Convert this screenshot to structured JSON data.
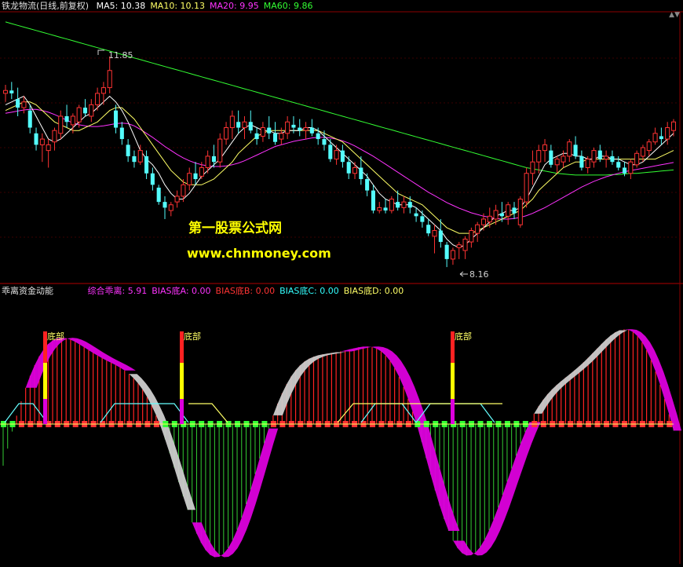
{
  "upper": {
    "title": "铁龙物流(日线,前复权)",
    "ma_labels": [
      {
        "text": "MA5: 10.38",
        "color": "#ffffff"
      },
      {
        "text": "MA10: 10.13",
        "color": "#ffff66"
      },
      {
        "text": "MA20: 9.95",
        "color": "#ff33ff"
      },
      {
        "text": "MA60: 9.86",
        "color": "#33ff33"
      }
    ],
    "high_label": "11.85",
    "low_label": "8.16",
    "ylim": [
      7.9,
      12.6
    ]
  },
  "lower": {
    "title": "乖离资金动能",
    "indicators": [
      {
        "text": "综合乖离: 5.91",
        "color": "#ff33ff"
      },
      {
        "text": "BIAS底A: 0.00",
        "color": "#ff33ff"
      },
      {
        "text": "BIAS底B: 0.00",
        "color": "#ff3333"
      },
      {
        "text": "BIAS底C: 0.00",
        "color": "#33ffff"
      },
      {
        "text": "BIAS底D: 0.00",
        "color": "#ffff66"
      }
    ],
    "bottom_marker_label": "底部"
  },
  "watermark": {
    "line1": "第一股票公式网",
    "line2": "www.chnmoney.com"
  },
  "colors": {
    "up": "#ff3333",
    "down": "#54fcfc",
    "ma5": "#ffffff",
    "ma10": "#ffff66",
    "ma20": "#ff33ff",
    "ma60": "#33ff33",
    "grid": "#8b0000"
  },
  "chart_data": {
    "type": "candlestick",
    "ohlc": [
      [
        11.2,
        11.35,
        11.05,
        11.25
      ],
      [
        11.25,
        11.4,
        11.1,
        11.2
      ],
      [
        11.1,
        11.3,
        10.8,
        10.95
      ],
      [
        10.95,
        11.15,
        10.85,
        11.05
      ],
      [
        10.9,
        11.0,
        10.5,
        10.6
      ],
      [
        10.5,
        10.6,
        10.2,
        10.3
      ],
      [
        10.3,
        10.5,
        10.0,
        10.4
      ],
      [
        10.2,
        10.4,
        9.9,
        10.3
      ],
      [
        10.35,
        10.6,
        10.2,
        10.55
      ],
      [
        10.5,
        10.9,
        10.4,
        10.8
      ],
      [
        10.8,
        11.0,
        10.6,
        10.7
      ],
      [
        10.65,
        10.85,
        10.5,
        10.8
      ],
      [
        10.7,
        11.0,
        10.6,
        10.95
      ],
      [
        10.95,
        11.1,
        10.8,
        10.85
      ],
      [
        10.8,
        11.1,
        10.7,
        11.0
      ],
      [
        11.0,
        11.3,
        10.9,
        11.2
      ],
      [
        11.2,
        11.4,
        11.0,
        11.3
      ],
      [
        11.3,
        11.85,
        11.2,
        11.6
      ],
      [
        10.9,
        11.0,
        10.5,
        10.6
      ],
      [
        10.6,
        10.7,
        10.3,
        10.4
      ],
      [
        10.3,
        10.4,
        10.0,
        10.1
      ],
      [
        10.1,
        10.2,
        9.9,
        10.0
      ],
      [
        10.0,
        10.3,
        9.95,
        10.2
      ],
      [
        10.1,
        10.2,
        9.7,
        9.8
      ],
      [
        9.8,
        9.9,
        9.5,
        9.6
      ],
      [
        9.55,
        9.6,
        9.25,
        9.3
      ],
      [
        9.3,
        9.4,
        9.0,
        9.2
      ],
      [
        9.15,
        9.3,
        9.05,
        9.25
      ],
      [
        9.3,
        9.5,
        9.2,
        9.4
      ],
      [
        9.4,
        9.7,
        9.3,
        9.6
      ],
      [
        9.6,
        9.9,
        9.5,
        9.8
      ],
      [
        9.8,
        10.0,
        9.6,
        9.7
      ],
      [
        9.75,
        10.0,
        9.7,
        9.9
      ],
      [
        9.9,
        10.2,
        9.8,
        10.1
      ],
      [
        10.1,
        10.3,
        9.9,
        10.0
      ],
      [
        10.0,
        10.5,
        9.9,
        10.4
      ],
      [
        10.4,
        10.7,
        10.3,
        10.6
      ],
      [
        10.6,
        10.9,
        10.4,
        10.8
      ],
      [
        10.7,
        10.9,
        10.5,
        10.6
      ],
      [
        10.6,
        10.8,
        10.4,
        10.7
      ],
      [
        10.7,
        10.9,
        10.5,
        10.55
      ],
      [
        10.5,
        10.6,
        10.3,
        10.4
      ],
      [
        10.45,
        10.7,
        10.35,
        10.6
      ],
      [
        10.6,
        10.8,
        10.4,
        10.5
      ],
      [
        10.5,
        10.7,
        10.3,
        10.35
      ],
      [
        10.4,
        10.6,
        10.3,
        10.5
      ],
      [
        10.5,
        10.8,
        10.4,
        10.7
      ],
      [
        10.65,
        10.8,
        10.5,
        10.6
      ],
      [
        10.6,
        10.75,
        10.45,
        10.55
      ],
      [
        10.55,
        10.7,
        10.4,
        10.6
      ],
      [
        10.6,
        10.75,
        10.45,
        10.5
      ],
      [
        10.5,
        10.6,
        10.3,
        10.4
      ],
      [
        10.4,
        10.55,
        10.2,
        10.3
      ],
      [
        10.3,
        10.4,
        10.0,
        10.05
      ],
      [
        10.05,
        10.3,
        9.95,
        10.2
      ],
      [
        10.2,
        10.3,
        9.9,
        10.0
      ],
      [
        10.0,
        10.1,
        9.7,
        9.8
      ],
      [
        9.8,
        10.0,
        9.7,
        9.9
      ],
      [
        9.9,
        10.1,
        9.6,
        9.7
      ],
      [
        9.7,
        9.8,
        9.4,
        9.5
      ],
      [
        9.5,
        9.6,
        9.1,
        9.15
      ],
      [
        9.15,
        9.3,
        9.1,
        9.2
      ],
      [
        9.2,
        9.35,
        9.1,
        9.15
      ],
      [
        9.15,
        9.4,
        9.1,
        9.35
      ],
      [
        9.3,
        9.5,
        9.15,
        9.2
      ],
      [
        9.2,
        9.4,
        9.1,
        9.3
      ],
      [
        9.3,
        9.4,
        9.1,
        9.2
      ],
      [
        9.1,
        9.2,
        8.95,
        9.05
      ],
      [
        9.05,
        9.15,
        8.85,
        8.95
      ],
      [
        8.9,
        9.0,
        8.7,
        8.75
      ],
      [
        8.7,
        8.9,
        8.4,
        8.8
      ],
      [
        8.8,
        9.0,
        8.5,
        8.6
      ],
      [
        8.55,
        8.6,
        8.16,
        8.3
      ],
      [
        8.3,
        8.5,
        8.2,
        8.45
      ],
      [
        8.5,
        8.6,
        8.3,
        8.55
      ],
      [
        8.45,
        8.7,
        8.3,
        8.65
      ],
      [
        8.6,
        8.85,
        8.5,
        8.8
      ],
      [
        8.75,
        8.95,
        8.6,
        8.9
      ],
      [
        8.9,
        9.1,
        8.8,
        9.0
      ],
      [
        8.95,
        9.2,
        8.85,
        9.05
      ],
      [
        9.0,
        9.25,
        8.9,
        9.15
      ],
      [
        9.1,
        9.3,
        8.95,
        9.05
      ],
      [
        9.05,
        9.3,
        8.9,
        9.25
      ],
      [
        9.2,
        9.3,
        9.0,
        9.1
      ],
      [
        8.9,
        9.4,
        8.85,
        9.35
      ],
      [
        9.3,
        9.9,
        9.2,
        9.8
      ],
      [
        9.8,
        10.2,
        9.6,
        10.0
      ],
      [
        10.0,
        10.3,
        9.8,
        10.2
      ],
      [
        10.2,
        10.4,
        10.0,
        10.3
      ],
      [
        10.2,
        10.3,
        9.9,
        9.95
      ],
      [
        9.95,
        10.1,
        9.8,
        10.05
      ],
      [
        10.0,
        10.2,
        9.9,
        10.1
      ],
      [
        10.1,
        10.4,
        10.0,
        10.35
      ],
      [
        10.3,
        10.45,
        10.05,
        10.1
      ],
      [
        10.1,
        10.2,
        9.85,
        9.9
      ],
      [
        9.9,
        10.1,
        9.8,
        10.05
      ],
      [
        10.0,
        10.25,
        9.9,
        10.2
      ],
      [
        10.2,
        10.3,
        10.0,
        10.05
      ],
      [
        10.05,
        10.2,
        9.9,
        10.1
      ],
      [
        10.1,
        10.2,
        9.95,
        10.0
      ],
      [
        10.0,
        10.1,
        9.85,
        9.9
      ],
      [
        9.9,
        10.0,
        9.75,
        9.8
      ],
      [
        9.8,
        10.05,
        9.7,
        10.0
      ],
      [
        9.95,
        10.2,
        9.9,
        10.15
      ],
      [
        10.1,
        10.3,
        10.0,
        10.25
      ],
      [
        10.2,
        10.4,
        10.1,
        10.35
      ],
      [
        10.35,
        10.6,
        10.3,
        10.5
      ],
      [
        10.45,
        10.6,
        10.3,
        10.4
      ],
      [
        10.4,
        10.7,
        10.3,
        10.6
      ],
      [
        10.55,
        10.75,
        10.45,
        10.7
      ]
    ],
    "ma5": [
      11.0,
      11.05,
      11.1,
      11.15,
      11.0,
      10.8,
      10.6,
      10.4,
      10.35,
      10.4,
      10.5,
      10.6,
      10.7,
      10.8,
      10.85,
      10.95,
      11.05,
      11.15,
      11.05,
      10.9,
      10.7,
      10.45,
      10.2,
      10.05,
      9.95,
      9.8,
      9.6,
      9.45,
      9.35,
      9.35,
      9.45,
      9.6,
      9.75,
      9.85,
      9.95,
      10.05,
      10.2,
      10.35,
      10.5,
      10.6,
      10.65,
      10.6,
      10.55,
      10.55,
      10.5,
      10.5,
      10.55,
      10.55,
      10.55,
      10.6,
      10.6,
      10.55,
      10.45,
      10.35,
      10.25,
      10.15,
      10.05,
      9.95,
      9.85,
      9.75,
      9.6,
      9.45,
      9.35,
      9.3,
      9.25,
      9.25,
      9.25,
      9.2,
      9.1,
      9.0,
      8.9,
      8.8,
      8.65,
      8.55,
      8.5,
      8.55,
      8.65,
      8.75,
      8.85,
      8.95,
      9.05,
      9.1,
      9.15,
      9.15,
      9.2,
      9.35,
      9.55,
      9.75,
      9.95,
      10.05,
      10.1,
      10.15,
      10.15,
      10.1,
      10.1,
      10.05,
      10.05,
      10.1,
      10.1,
      10.05,
      10.05,
      10.0,
      9.95,
      9.95,
      10.0,
      10.1,
      10.2,
      10.3,
      10.4,
      10.5
    ],
    "ma10": [
      10.9,
      10.95,
      11.0,
      11.05,
      11.05,
      11.0,
      10.9,
      10.8,
      10.7,
      10.65,
      10.6,
      10.55,
      10.55,
      10.6,
      10.65,
      10.7,
      10.8,
      10.9,
      10.95,
      10.95,
      10.85,
      10.75,
      10.6,
      10.45,
      10.3,
      10.15,
      10.0,
      9.85,
      9.75,
      9.65,
      9.6,
      9.6,
      9.6,
      9.65,
      9.7,
      9.8,
      9.9,
      10.0,
      10.15,
      10.25,
      10.35,
      10.45,
      10.5,
      10.55,
      10.55,
      10.55,
      10.55,
      10.55,
      10.55,
      10.55,
      10.55,
      10.55,
      10.5,
      10.45,
      10.4,
      10.35,
      10.25,
      10.15,
      10.05,
      9.95,
      9.85,
      9.75,
      9.65,
      9.55,
      9.45,
      9.4,
      9.35,
      9.3,
      9.25,
      9.15,
      9.05,
      8.95,
      8.85,
      8.8,
      8.75,
      8.75,
      8.75,
      8.8,
      8.85,
      8.9,
      8.95,
      9.0,
      9.05,
      9.1,
      9.15,
      9.25,
      9.35,
      9.5,
      9.6,
      9.7,
      9.8,
      9.9,
      9.95,
      10.0,
      10.0,
      10.05,
      10.05,
      10.05,
      10.05,
      10.05,
      10.05,
      10.05,
      10.05,
      10.05,
      10.05,
      10.05,
      10.05,
      10.1,
      10.15,
      10.2
    ],
    "ma20": [
      10.85,
      10.87,
      10.89,
      10.91,
      10.92,
      10.92,
      10.9,
      10.87,
      10.83,
      10.78,
      10.73,
      10.68,
      10.65,
      10.63,
      10.62,
      10.62,
      10.63,
      10.65,
      10.67,
      10.68,
      10.67,
      10.63,
      10.57,
      10.5,
      10.43,
      10.35,
      10.27,
      10.2,
      10.13,
      10.07,
      10.02,
      9.98,
      9.95,
      9.93,
      9.92,
      9.92,
      9.93,
      9.95,
      9.98,
      10.02,
      10.07,
      10.12,
      10.17,
      10.22,
      10.27,
      10.3,
      10.33,
      10.36,
      10.38,
      10.4,
      10.42,
      10.43,
      10.43,
      10.42,
      10.4,
      10.37,
      10.33,
      10.28,
      10.22,
      10.16,
      10.1,
      10.03,
      9.96,
      9.89,
      9.82,
      9.75,
      9.68,
      9.61,
      9.54,
      9.47,
      9.41,
      9.35,
      9.29,
      9.24,
      9.19,
      9.15,
      9.11,
      9.08,
      9.05,
      9.03,
      9.01,
      9.0,
      9.0,
      9.01,
      9.03,
      9.06,
      9.1,
      9.15,
      9.2,
      9.26,
      9.32,
      9.38,
      9.44,
      9.5,
      9.56,
      9.61,
      9.66,
      9.7,
      9.74,
      9.77,
      9.8,
      9.83,
      9.85,
      9.87,
      9.89,
      9.91,
      9.93,
      9.95,
      9.97,
      9.99
    ],
    "ma60": [
      12.45,
      12.42,
      12.39,
      12.36,
      12.33,
      12.3,
      12.27,
      12.24,
      12.21,
      12.18,
      12.15,
      12.12,
      12.09,
      12.06,
      12.03,
      12.0,
      11.97,
      11.94,
      11.91,
      11.88,
      11.85,
      11.82,
      11.79,
      11.76,
      11.73,
      11.7,
      11.67,
      11.64,
      11.61,
      11.58,
      11.55,
      11.52,
      11.49,
      11.46,
      11.43,
      11.4,
      11.37,
      11.34,
      11.31,
      11.28,
      11.25,
      11.22,
      11.19,
      11.16,
      11.13,
      11.1,
      11.07,
      11.04,
      11.01,
      10.98,
      10.95,
      10.92,
      10.89,
      10.86,
      10.83,
      10.8,
      10.77,
      10.74,
      10.71,
      10.68,
      10.65,
      10.62,
      10.59,
      10.56,
      10.53,
      10.5,
      10.47,
      10.44,
      10.41,
      10.38,
      10.35,
      10.32,
      10.29,
      10.26,
      10.23,
      10.2,
      10.17,
      10.14,
      10.11,
      10.08,
      10.05,
      10.02,
      9.99,
      9.96,
      9.93,
      9.9,
      9.88,
      9.86,
      9.84,
      9.82,
      9.8,
      9.79,
      9.78,
      9.77,
      9.77,
      9.77,
      9.77,
      9.77,
      9.77,
      9.78,
      9.78,
      9.79,
      9.8,
      9.8,
      9.81,
      9.82,
      9.83,
      9.84,
      9.85,
      9.86
    ]
  }
}
